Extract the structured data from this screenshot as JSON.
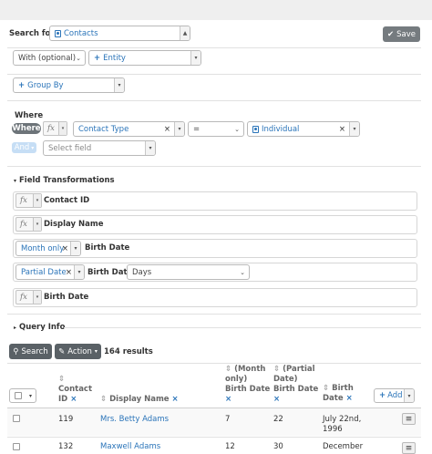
{
  "header": {
    "search_for_label": "Search for",
    "entity_value": "Contacts",
    "save_label": "Save"
  },
  "join": {
    "with_value": "With (optional)",
    "entity_label": "Entity"
  },
  "group_by": {
    "label": "Group By"
  },
  "where": {
    "section_label": "Where",
    "where_pill": "Where",
    "field_value": "Contact Type",
    "operator_value": "=",
    "value_value": "Individual",
    "and_pill": "And",
    "select_field_placeholder": "Select field"
  },
  "transformations": {
    "section_label": "Field Transformations",
    "fx_symbol": "fx",
    "rows": [
      {
        "field": "Contact ID"
      },
      {
        "field": "Display Name"
      },
      {
        "function": "Month only",
        "field": "Birth Date"
      },
      {
        "function": "Partial Date",
        "field": "Birth Date",
        "option": "Days"
      },
      {
        "field": "Birth Date"
      }
    ]
  },
  "query_info": {
    "label": "Query Info"
  },
  "results": {
    "search_label": "Search",
    "action_label": "Action",
    "count_text": "164 results",
    "add_label": "Add",
    "columns": [
      {
        "lines": [
          "",
          "Contact",
          "ID"
        ]
      },
      {
        "lines": [
          "Display Name"
        ]
      },
      {
        "lines": [
          "(Month",
          "only)",
          "Birth Date"
        ]
      },
      {
        "lines": [
          "(Partial",
          "Date)",
          "Birth Date"
        ]
      },
      {
        "lines": [
          "Birth",
          "Date"
        ]
      }
    ],
    "rows": [
      {
        "id": "119",
        "name": "Mrs. Betty Adams",
        "month": "7",
        "partial": "22",
        "birth": [
          "July 22nd,",
          "1996"
        ]
      },
      {
        "id": "132",
        "name": "Maxwell Adams",
        "month": "12",
        "partial": "30",
        "birth": [
          "December",
          ""
        ]
      }
    ]
  }
}
